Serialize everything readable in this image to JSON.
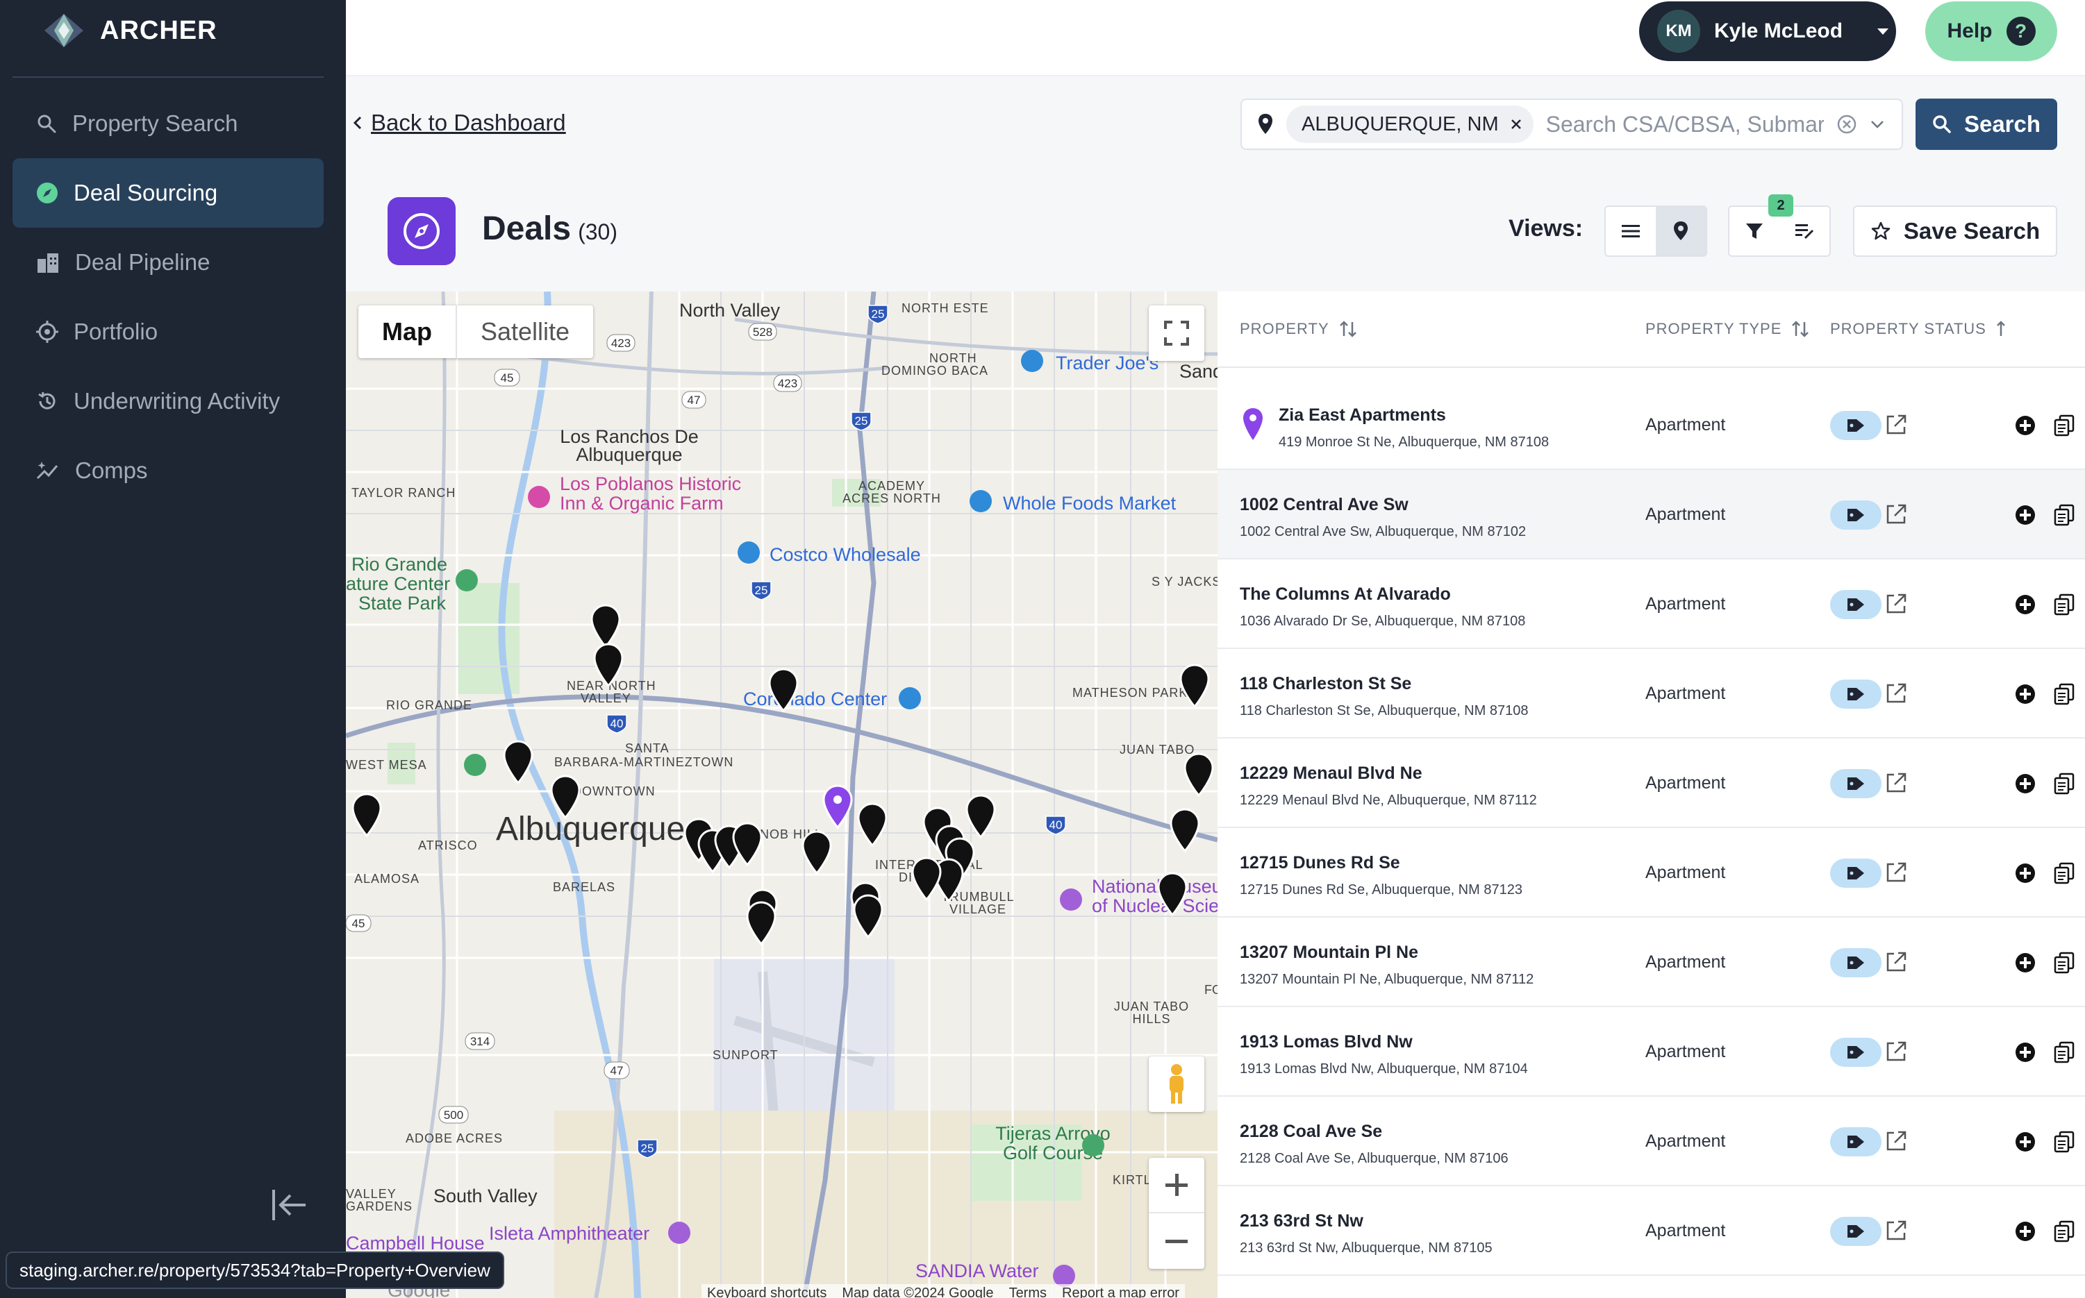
{
  "app": {
    "name": "ARCHER"
  },
  "sidebar": {
    "items": [
      {
        "label": "Property Search",
        "icon": "search-icon",
        "active": false
      },
      {
        "label": "Deal Sourcing",
        "icon": "compass-icon",
        "active": true
      },
      {
        "label": "Deal Pipeline",
        "icon": "buildings-icon",
        "active": false
      },
      {
        "label": "Portfolio",
        "icon": "target-icon",
        "active": false
      },
      {
        "label": "Underwriting Activity",
        "icon": "history-icon",
        "active": false
      },
      {
        "label": "Comps",
        "icon": "sparkle-chart-icon",
        "active": false
      }
    ]
  },
  "status_url": "staging.archer.re/property/573534?tab=Property+Overview",
  "user": {
    "initials": "KM",
    "name": "Kyle McLeod"
  },
  "help": {
    "label": "Help",
    "glyph": "?"
  },
  "back": {
    "label": "Back to Dashboard"
  },
  "search": {
    "chip": "ALBUQUERQUE, NM",
    "placeholder": "Search CSA/CBSA, Submarket",
    "button": "Search"
  },
  "deals": {
    "title": "Deals",
    "count": "(30)"
  },
  "views": {
    "label": "Views:"
  },
  "filters": {
    "badge": "2"
  },
  "save_search": {
    "label": "Save Search"
  },
  "map": {
    "tabs": [
      "Map",
      "Satellite"
    ],
    "footer": [
      "Keyboard shortcuts",
      "Map data ©2024 Google",
      "Terms",
      "Report a map error"
    ],
    "labels": {
      "north_valley": "North Valley",
      "north_este": "NORTH ESTE",
      "north_domingo": "NORTH",
      "domingo_baca": "DOMINGO BACA",
      "trader_joes": "Trader Joe's",
      "sand": "Sand",
      "los_ranchos_1": "Los Ranchos De",
      "los_ranchos_2": "Albuquerque",
      "taylor_ranch": "TAYLOR RANCH",
      "poblanos_1": "Los Poblanos Historic",
      "poblanos_2": "Inn & Organic Farm",
      "academy_1": "ACADEMY",
      "academy_2": "ACRES NORTH",
      "whole_foods": "Whole Foods Market",
      "rio_grande_1": "Rio Grande",
      "rio_grande_2": "ature Center",
      "rio_grande_3": "State Park",
      "costco": "Costco Wholesale",
      "sy_jacks": "S Y JACKS",
      "near_north_1": "NEAR NORTH",
      "near_north_2": "VALLEY",
      "coronado": "Coronado Center",
      "matheson": "MATHESON PARK",
      "rio_grande_nb": "RIO GRANDE",
      "santa_1": "SANTA",
      "santa_2": "BARBARA-MARTINEZTOWN",
      "juan_tabo": "JUAN TABO",
      "west_mesa": "WEST MESA",
      "downtown": "DOWNTOWN",
      "city": "Albuquerque",
      "atrisco": "ATRISCO",
      "nob_hill": "NOB HILL",
      "alamosa": "ALAMOSA",
      "barelas": "BARELAS",
      "inter_1": "INTERNATIONAL",
      "inter_2": "DISTRICT",
      "trumbull_1": "TRUMBULL",
      "trumbull_2": "VILLAGE",
      "museum_1": "National Museum",
      "museum_2": "of Nuclear Science",
      "juan_tabo_hills_1": "JUAN TABO",
      "juan_tabo_hills_2": "HILLS",
      "fo": "FO",
      "sunport": "SUNPORT",
      "adobe": "ADOBE ACRES",
      "tijeras_1": "Tijeras Arroyo",
      "tijeras_2": "Golf Course",
      "kirtland": "KIRTLAND",
      "valley_gardens_1": "VALLEY",
      "valley_gardens_2": "GARDENS",
      "south_valley": "South Valley",
      "isleta": "Isleta Amphitheater",
      "bell_house": "Campbell House",
      "sandia": "SANDIA Water",
      "google": "Google"
    },
    "shields": [
      "423",
      "528",
      "25",
      "45",
      "423",
      "47",
      "25",
      "25",
      "40",
      "40",
      "45",
      "314",
      "47",
      "500",
      "25"
    ]
  },
  "table": {
    "columns": [
      "PROPERTY",
      "PROPERTY TYPE",
      "PROPERTY STATUS"
    ],
    "rows": [
      {
        "name": "Zia East Apartments",
        "address": "419 Monroe St Ne, Albuquerque, NM 87108",
        "type": "Apartment"
      },
      {
        "name": "1002 Central Ave Sw",
        "address": "1002 Central Ave Sw, Albuquerque, NM 87102",
        "type": "Apartment"
      },
      {
        "name": "The Columns At Alvarado",
        "address": "1036 Alvarado Dr Se, Albuquerque, NM 87108",
        "type": "Apartment"
      },
      {
        "name": "118 Charleston St Se",
        "address": "118 Charleston St Se, Albuquerque, NM 87108",
        "type": "Apartment"
      },
      {
        "name": "12229 Menaul Blvd Ne",
        "address": "12229 Menaul Blvd Ne, Albuquerque, NM 87112",
        "type": "Apartment"
      },
      {
        "name": "12715 Dunes Rd Se",
        "address": "12715 Dunes Rd Se, Albuquerque, NM 87123",
        "type": "Apartment"
      },
      {
        "name": "13207 Mountain Pl Ne",
        "address": "13207 Mountain Pl Ne, Albuquerque, NM 87112",
        "type": "Apartment"
      },
      {
        "name": "1913 Lomas Blvd Nw",
        "address": "1913 Lomas Blvd Nw, Albuquerque, NM 87104",
        "type": "Apartment"
      },
      {
        "name": "2128 Coal Ave Se",
        "address": "2128 Coal Ave Se, Albuquerque, NM 87106",
        "type": "Apartment"
      },
      {
        "name": "213 63rd St Nw",
        "address": "213 63rd St Nw, Albuquerque, NM 87105",
        "type": "Apartment"
      }
    ]
  },
  "colors": {
    "sidebar": "#1e2533",
    "active": "#28415b",
    "accent": "#6c3bd9",
    "help": "#8ee0b2",
    "search": "#2c4f78",
    "tag": "#bfe0f7"
  }
}
